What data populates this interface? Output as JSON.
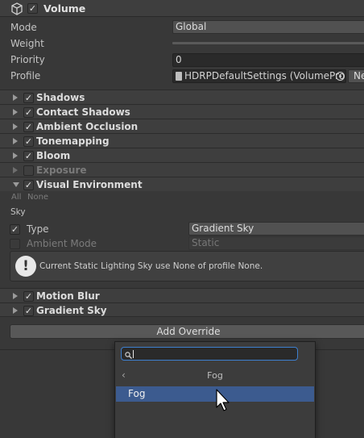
{
  "header": {
    "title": "Volume"
  },
  "fields": {
    "mode_label": "Mode",
    "mode_value": "Global",
    "weight_label": "Weight",
    "priority_label": "Priority",
    "priority_value": "0",
    "profile_label": "Profile",
    "profile_value": "HDRPDefaultSettings (VolumePro",
    "profile_new_label": "Ne"
  },
  "sections": [
    {
      "label": "Shadows",
      "enabled": true
    },
    {
      "label": "Contact Shadows",
      "enabled": true
    },
    {
      "label": "Ambient Occlusion",
      "enabled": true
    },
    {
      "label": "Tonemapping",
      "enabled": true
    },
    {
      "label": "Bloom",
      "enabled": true
    },
    {
      "label": "Exposure",
      "enabled": false
    },
    {
      "label": "Visual Environment",
      "enabled": true,
      "expanded": true
    },
    {
      "label": "Motion Blur",
      "enabled": true
    },
    {
      "label": "Gradient Sky",
      "enabled": true
    }
  ],
  "visual_environment": {
    "all_label": "All",
    "none_label": "None",
    "sky_header": "Sky",
    "type_label": "Type",
    "type_value": "Gradient Sky",
    "ambient_label": "Ambient Mode",
    "ambient_value": "Static",
    "warning_text": "Current Static Lighting Sky use None of profile None."
  },
  "add_override_label": "Add Override",
  "dropdown": {
    "search_value": "",
    "breadcrumb": "Fog",
    "items": [
      "Fog"
    ]
  },
  "colors": {
    "highlight": "#3c5b8f",
    "search_border": "#3d7fcf"
  }
}
